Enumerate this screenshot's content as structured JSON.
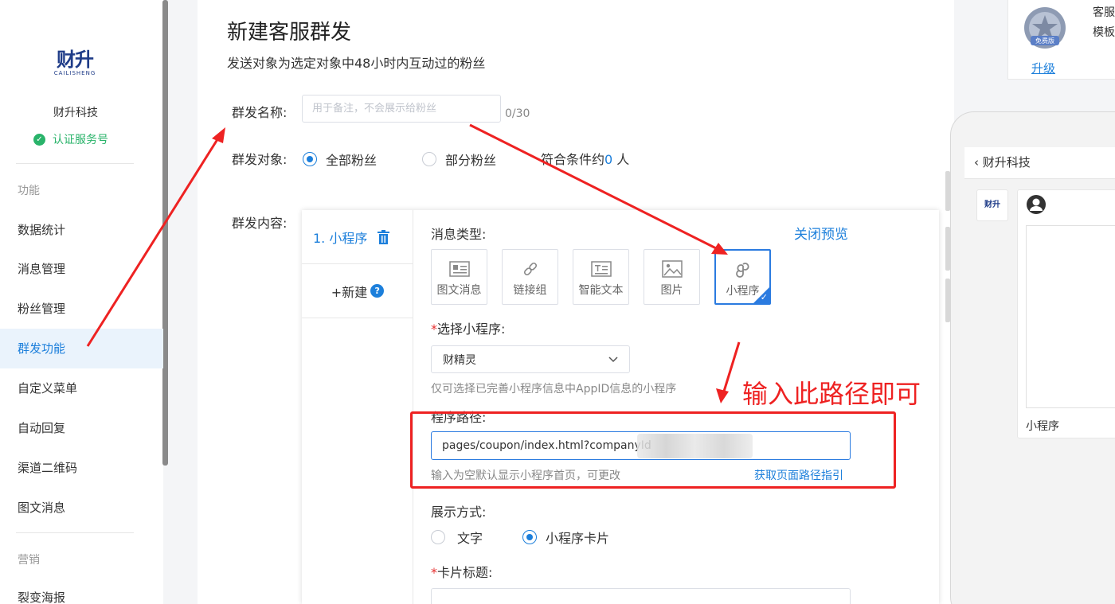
{
  "colors": {
    "accent": "#1c7fdb",
    "success": "#29b36a",
    "annotation_red": "#ee2222"
  },
  "sidebar": {
    "logo_text": "财升",
    "logo_sub": "CAILISHENG",
    "company": "财升科技",
    "verified": "认证服务号",
    "section_function": "功能",
    "items": [
      "数据统计",
      "消息管理",
      "粉丝管理",
      "群发功能",
      "自定义菜单",
      "自动回复",
      "渠道二维码",
      "图文消息"
    ],
    "section_marketing": "营销",
    "item_fission": "裂变海报",
    "active": "群发功能"
  },
  "page": {
    "title": "新建客服群发",
    "subtitle": "发送对象为选定对象中48小时内互动过的粉丝"
  },
  "form": {
    "name_label": "群发名称:",
    "name_placeholder": "用于备注，不会展示给粉丝",
    "name_counter": "0/30",
    "target_label": "群发对象:",
    "target_all": "全部粉丝",
    "target_part": "部分粉丝",
    "cond_prefix": "符合条件约",
    "cond_count": "0",
    "cond_suffix": " 人",
    "content_label": "群发内容:"
  },
  "content": {
    "item1_label": "1.  小程序",
    "add_new": "+新建",
    "close_preview": "关闭预览",
    "msg_type_label": "消息类型:",
    "types": [
      {
        "label": "图文消息",
        "icon": "news-icon"
      },
      {
        "label": "链接组",
        "icon": "link-group-icon"
      },
      {
        "label": "智能文本",
        "icon": "smart-text-icon"
      },
      {
        "label": "图片",
        "icon": "image-icon"
      },
      {
        "label": "小程序",
        "icon": "mini-program-icon"
      }
    ],
    "selected_type": "小程序",
    "select_mp_label": "选择小程序:",
    "select_mp_value": "财精灵",
    "select_mp_hint": "仅可选择已完善小程序信息中AppID信息的小程序",
    "path_label": "程序路径:",
    "path_value": "pages/coupon/index.html?companyId",
    "path_hint": "输入为空默认显示小程序首页，可更改",
    "path_guide": "获取页面路径指引",
    "display_label": "展示方式:",
    "display_text": "文字",
    "display_card": "小程序卡片",
    "card_title_label": "卡片标题:"
  },
  "annotation": {
    "text": "输入此路径即可"
  },
  "upgrade": {
    "badge": "免费版",
    "link": "升级",
    "side_line1": "客服",
    "side_line2": "模板"
  },
  "preview": {
    "header": "财升科技",
    "avatar_text": "财升",
    "mini_label": "小程序"
  }
}
